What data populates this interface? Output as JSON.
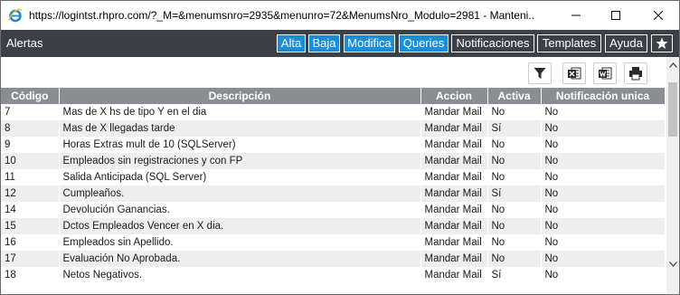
{
  "window": {
    "title": "https://logintst.rhpro.com/?_M=&menumsnro=2935&menunro=72&MenumsNro_Modulo=2981 - Manteni..."
  },
  "header": {
    "title": "Alertas",
    "buttons": {
      "alta": "Alta",
      "baja": "Baja",
      "modifica": "Modifica",
      "queries": "Queries",
      "notificaciones": "Notificaciones",
      "templates": "Templates",
      "ayuda": "Ayuda"
    }
  },
  "colors": {
    "header_bg": "#3c4148",
    "accent_blue": "#1c8ed6",
    "table_header_bg": "#8a8e93",
    "row_alt_bg": "#eeeeee"
  },
  "icons": [
    "ie-logo-icon",
    "minimize-icon",
    "maximize-icon",
    "close-icon",
    "star-icon",
    "filter-icon",
    "excel-icon",
    "word-icon",
    "print-icon",
    "scroll-up-icon",
    "scroll-down-icon"
  ],
  "table": {
    "columns": {
      "codigo": "Código",
      "descripcion": "Descripción",
      "accion": "Accion",
      "activa": "Activa",
      "notificacion": "Notificación unica"
    },
    "rows": [
      {
        "codigo": "7",
        "descripcion": "Mas de X hs de tipo Y en el dia",
        "accion": "Mandar Mail",
        "activa": "No",
        "notificacion": "No"
      },
      {
        "codigo": "8",
        "descripcion": "Mas de X llegadas tarde",
        "accion": "Mandar Mail",
        "activa": "Sí",
        "notificacion": "No"
      },
      {
        "codigo": "9",
        "descripcion": "Horas Extras mult de 10 (SQLServer)",
        "accion": "Mandar Mail",
        "activa": "No",
        "notificacion": "No"
      },
      {
        "codigo": "10",
        "descripcion": "Empleados sin registraciones y con FP",
        "accion": "Mandar Mail",
        "activa": "No",
        "notificacion": "No"
      },
      {
        "codigo": "11",
        "descripcion": "Salida Anticipada (SQL Server)",
        "accion": "Mandar Mail",
        "activa": "No",
        "notificacion": "No"
      },
      {
        "codigo": "12",
        "descripcion": "Cumpleaños.",
        "accion": "Mandar Mail",
        "activa": "Sí",
        "notificacion": "No"
      },
      {
        "codigo": "14",
        "descripcion": "Devolución Ganancias.",
        "accion": "Mandar Mail",
        "activa": "No",
        "notificacion": "No"
      },
      {
        "codigo": "15",
        "descripcion": "Dctos Empleados Vencer en X dia.",
        "accion": "Mandar Mail",
        "activa": "No",
        "notificacion": "No"
      },
      {
        "codigo": "16",
        "descripcion": "Empleados sin Apellido.",
        "accion": "Mandar Mail",
        "activa": "No",
        "notificacion": "No"
      },
      {
        "codigo": "17",
        "descripcion": "Evaluación No Aprobada.",
        "accion": "Mandar Mail",
        "activa": "No",
        "notificacion": "No"
      },
      {
        "codigo": "18",
        "descripcion": "Netos Negativos.",
        "accion": "Mandar Mail",
        "activa": "Sí",
        "notificacion": "No"
      }
    ]
  }
}
